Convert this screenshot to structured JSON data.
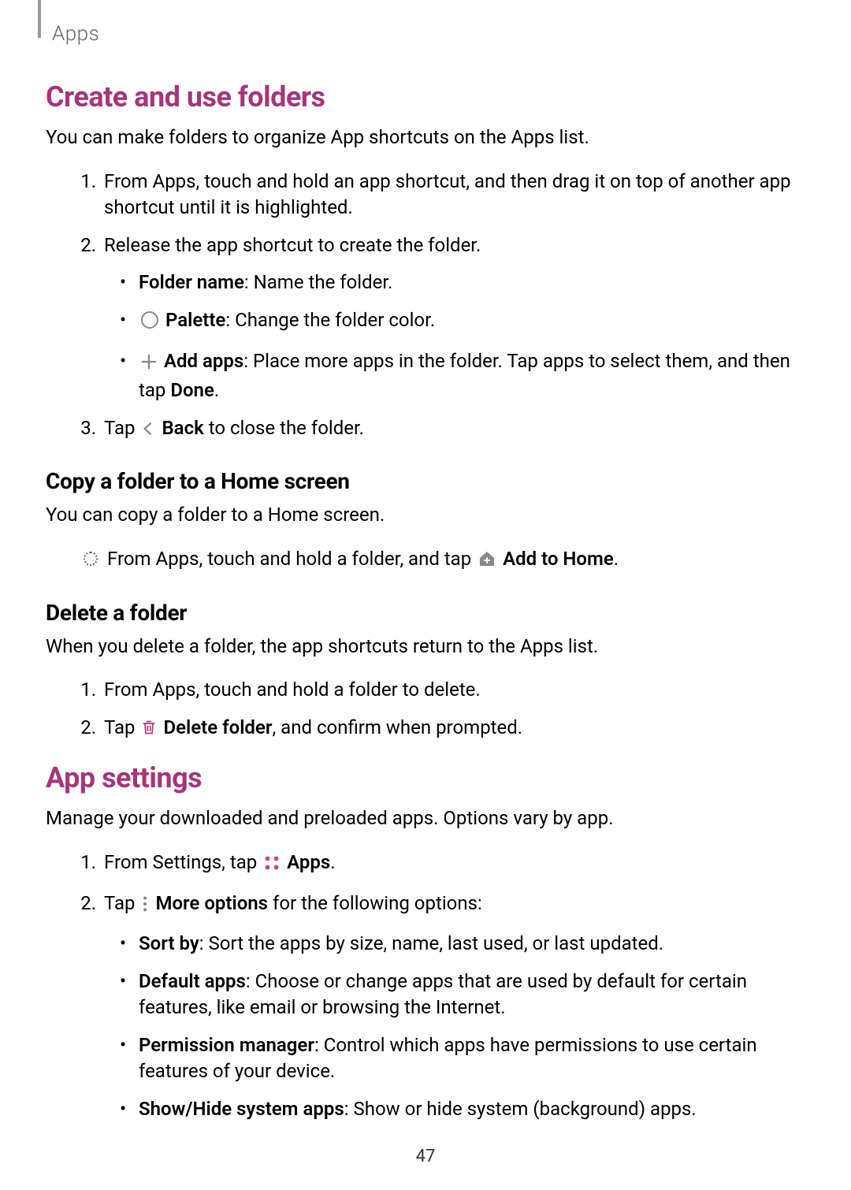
{
  "breadcrumb": "Apps",
  "section1": {
    "title": "Create and use folders",
    "intro": "You can make folders to organize App shortcuts on the Apps list.",
    "step1": "From Apps, touch and hold an app shortcut, and then drag it on top of another app shortcut until it is highlighted.",
    "step2": "Release the app shortcut to create the folder.",
    "sub_folder_name_label": "Folder name",
    "sub_folder_name_text": ": Name the folder.",
    "sub_palette_label": "Palette",
    "sub_palette_text": ": Change the folder color.",
    "sub_addapps_label": "Add apps",
    "sub_addapps_text": ": Place more apps in the folder. Tap apps to select them, and then tap ",
    "sub_addapps_done": "Done",
    "step3_pre": "Tap ",
    "step3_back": "Back",
    "step3_post": " to close the folder."
  },
  "section2": {
    "title": "Copy a folder to a Home screen",
    "intro": "You can copy a folder to a Home screen.",
    "item_pre": "From Apps, touch and hold a folder, and tap ",
    "item_label": "Add to Home",
    "item_post": "."
  },
  "section3": {
    "title": "Delete a folder",
    "intro": "When you delete a folder, the app shortcuts return to the Apps list.",
    "step1": "From Apps, touch and hold a folder to delete.",
    "step2_pre": "Tap ",
    "step2_label": "Delete folder",
    "step2_post": ", and confirm when prompted."
  },
  "section4": {
    "title": "App settings",
    "intro": "Manage your downloaded and preloaded apps. Options vary by app.",
    "step1_pre": "From Settings, tap ",
    "step1_label": "Apps",
    "step1_post": ".",
    "step2_pre": "Tap ",
    "step2_label": "More options",
    "step2_post": " for the following options:",
    "sortby_label": "Sort by",
    "sortby_text": ": Sort the apps by size, name, last used, or last updated.",
    "default_label": "Default apps",
    "default_text": ": Choose or change apps that are used by default for certain features, like email or browsing the Internet.",
    "perm_label": "Permission manager",
    "perm_text": ": Control which apps have permissions to use certain features of your device.",
    "showhide_label": "Show/Hide system apps",
    "showhide_text": ": Show or hide system (background) apps."
  },
  "page_number": "47"
}
